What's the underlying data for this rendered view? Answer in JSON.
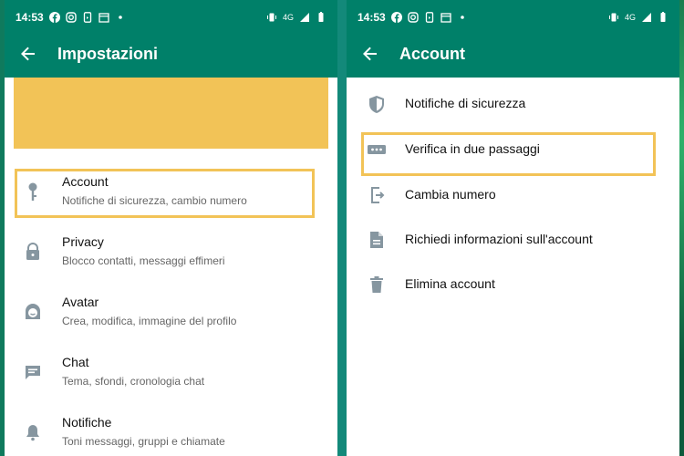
{
  "left_phone": {
    "status_time": "14:53",
    "network_label": "4G",
    "title": "Impostazioni",
    "items": [
      {
        "label": "Account",
        "subtitle": "Notifiche di sicurezza, cambio numero",
        "icon": "key-icon"
      },
      {
        "label": "Privacy",
        "subtitle": "Blocco contatti, messaggi effimeri",
        "icon": "lock-icon"
      },
      {
        "label": "Avatar",
        "subtitle": "Crea, modifica, immagine del profilo",
        "icon": "avatar-icon"
      },
      {
        "label": "Chat",
        "subtitle": "Tema, sfondi, cronologia chat",
        "icon": "chat-icon"
      },
      {
        "label": "Notifiche",
        "subtitle": "Toni messaggi, gruppi e chiamate",
        "icon": "bell-icon"
      }
    ]
  },
  "right_phone": {
    "status_time": "14:53",
    "network_label": "4G",
    "title": "Account",
    "items": [
      {
        "label": "Notifiche di sicurezza",
        "icon": "shield-icon"
      },
      {
        "label": "Verifica in due passaggi",
        "icon": "password-dots-icon"
      },
      {
        "label": "Cambia numero",
        "icon": "change-number-icon"
      },
      {
        "label": "Richiedi informazioni sull'account",
        "icon": "document-icon"
      },
      {
        "label": "Elimina account",
        "icon": "trash-icon"
      }
    ]
  },
  "colors": {
    "header": "#008069",
    "highlight": "#f2c357",
    "icon": "#8696a0"
  }
}
